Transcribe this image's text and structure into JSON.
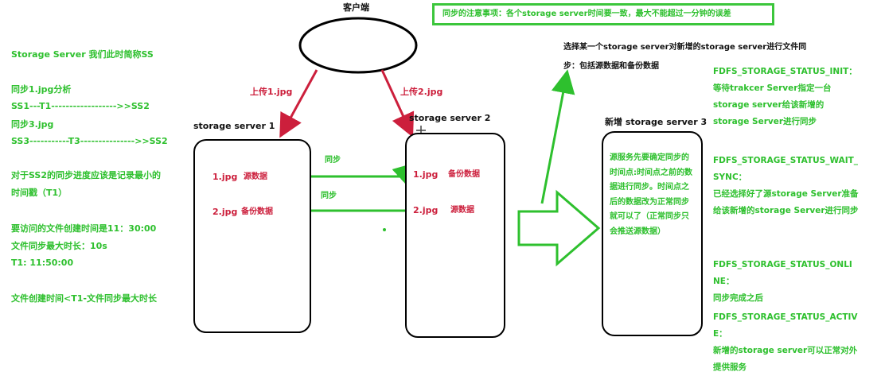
{
  "top_note": "同步的注意事项：各个storage server时间要一致，最大不能超过一分钟的误差",
  "client": {
    "label": "客户端"
  },
  "left_notes": {
    "line1": "Storage Server 我们此时简称SS",
    "line2": "同步1.jpg分析",
    "line3": "SS1---T1------------------>>SS2",
    "line4": "同步3.jpg",
    "line5": "SS3-----------T3--------------->>SS2",
    "line6": "对于SS2的同步进度应该是记录最小的",
    "line7": "时间戳（T1）",
    "line8": "要访问的文件创建时间是11：30:00",
    "line9": "文件同步最大时长：10s",
    "line10": "T1: 11:50:00",
    "line11": "文件创建时间<T1-文件同步最大时长"
  },
  "uploads": {
    "upload1": "上传1.jpg",
    "upload2": "上传2.jpg"
  },
  "servers": {
    "s1": {
      "title": "storage server 1",
      "row1_file": "1.jpg",
      "row1_tag": "源数据",
      "row2_file": "2.jpg",
      "row2_tag": "备份数据"
    },
    "s2": {
      "title": "storage server 2",
      "row1_file": "1.jpg",
      "row1_tag": "备份数据",
      "row2_file": "2.jpg",
      "row2_tag": "源数据"
    },
    "s3": {
      "title": "新增 storage  server 3",
      "text": "源服务先要确定同步的时间点:时间点之前的数据进行同步。时间点之后的数据改为正常同步就可以了（正常同步只会推送源数据）"
    }
  },
  "sync_labels": {
    "sync1": "同步",
    "sync2": "同步"
  },
  "new_server_note": {
    "line1": "选择某一个storage server对新增的storage server进行文件同",
    "line2": "步：包括源数据和备份数据"
  },
  "status": {
    "init_title": "FDFS_STORAGE_STATUS_INIT：",
    "init_desc": "等待trakcer Server指定一台storage server给该新增的storage Server进行同步",
    "wait_title": "FDFS_STORAGE_STATUS_WAIT_SYNC：",
    "wait_desc": "已经选择好了源storage Server准备给该新增的storage Server进行同步",
    "online_title": "FDFS_STORAGE_STATUS_ONLINE：",
    "online_desc": "同步完成之后",
    "active_title": "FDFS_STORAGE_STATUS_ACTIVE：",
    "active_desc": "新增的storage server可以正常对外提供服务"
  },
  "colors": {
    "green": "#2ec02e",
    "red": "#cc1f3c",
    "black": "#111111"
  }
}
